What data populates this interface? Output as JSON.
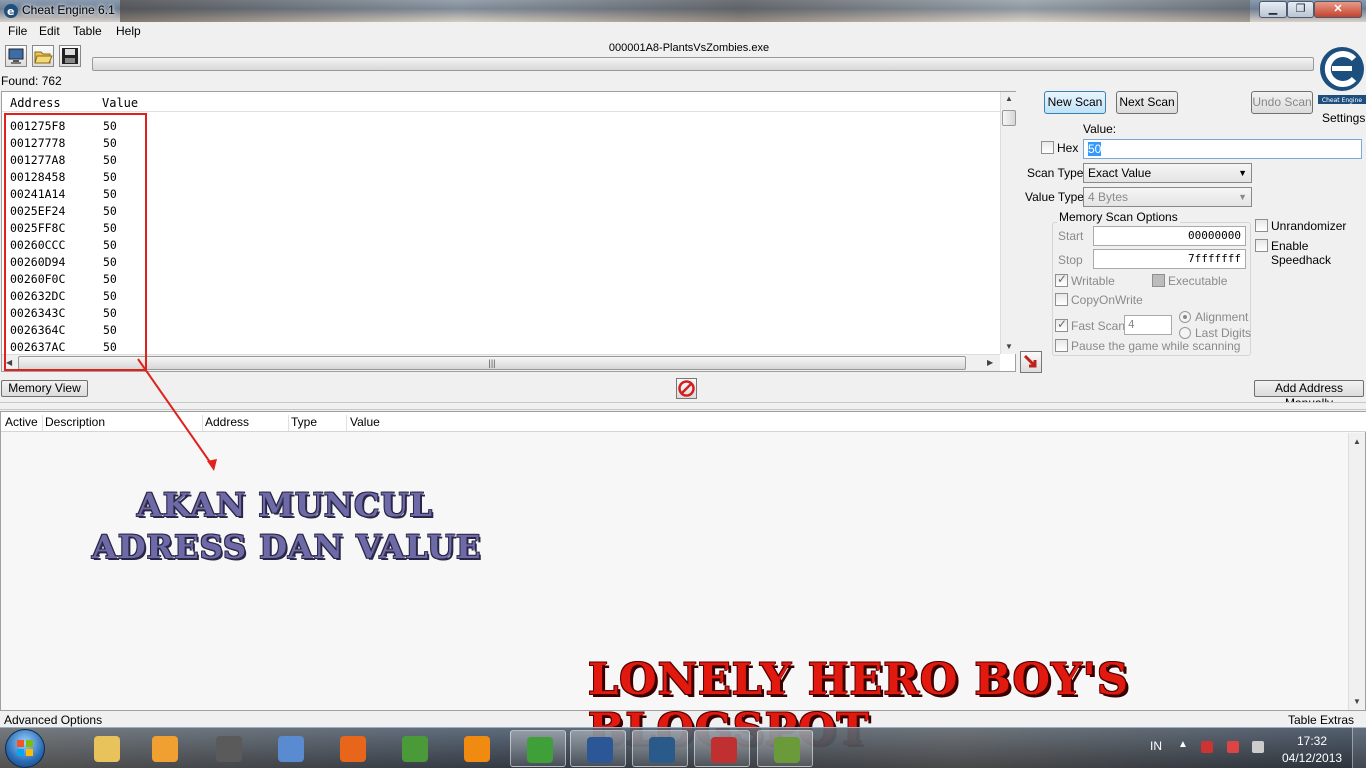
{
  "window": {
    "title": "Cheat Engine 6.1",
    "min_glyph": "▁",
    "max_glyph": "❐",
    "close_glyph": "✕"
  },
  "menu": [
    "File",
    "Edit",
    "Table",
    "Help"
  ],
  "toolbar": {
    "process_title": "000001A8-PlantsVsZombies.exe",
    "open_process_icon": "computer-icon",
    "open_file_icon": "folder-open-icon",
    "save_icon": "floppy-disk-icon"
  },
  "found": "Found: 762",
  "logo": {
    "name": "cheat-engine-logo",
    "text": "Cheat Engine"
  },
  "settings_label": "Settings",
  "results": {
    "columns": [
      "Address",
      "Value"
    ],
    "rows": [
      {
        "address": "001275F8",
        "value": "50"
      },
      {
        "address": "00127778",
        "value": "50"
      },
      {
        "address": "001277A8",
        "value": "50"
      },
      {
        "address": "00128458",
        "value": "50"
      },
      {
        "address": "00241A14",
        "value": "50"
      },
      {
        "address": "0025EF24",
        "value": "50"
      },
      {
        "address": "0025FF8C",
        "value": "50"
      },
      {
        "address": "00260CCC",
        "value": "50"
      },
      {
        "address": "00260D94",
        "value": "50"
      },
      {
        "address": "00260F0C",
        "value": "50"
      },
      {
        "address": "002632DC",
        "value": "50"
      },
      {
        "address": "0026343C",
        "value": "50"
      },
      {
        "address": "0026364C",
        "value": "50"
      },
      {
        "address": "002637AC",
        "value": "50"
      }
    ]
  },
  "scan": {
    "new_scan": "New Scan",
    "next_scan": "Next Scan",
    "undo_scan": "Undo Scan",
    "value_label": "Value:",
    "hex_label": "Hex",
    "hex_checked": false,
    "value": "50",
    "scan_type_label": "Scan Type",
    "scan_type": "Exact Value",
    "value_type_label": "Value Type",
    "value_type": "4 Bytes"
  },
  "memory_options": {
    "title": "Memory Scan Options",
    "start_label": "Start",
    "start": "00000000",
    "stop_label": "Stop",
    "stop": "7fffffff",
    "writable": "Writable",
    "executable": "Executable",
    "copy_on_write": "CopyOnWrite",
    "fast_scan": "Fast Scan",
    "fast_scan_value": "4",
    "alignment": "Alignment",
    "last_digits": "Last Digits",
    "pause_game": "Pause the game while scanning"
  },
  "extra_options": {
    "unrandomizer": "Unrandomizer",
    "enable_speedhack": "Enable Speedhack"
  },
  "buttons": {
    "memory_view": "Memory View",
    "add_address_manually": "Add Address Manually"
  },
  "address_table": {
    "columns": [
      "Active",
      "Description",
      "Address",
      "Type",
      "Value"
    ]
  },
  "footer": {
    "advanced_options": "Advanced Options",
    "table_extras": "Table Extras"
  },
  "annotations": {
    "line1": "AKAN MUNCUL",
    "line2": "ADRESS DAN VALUE",
    "blog_credit": "LONELY HERO BOY'S BLOGSPOT"
  },
  "colors": {
    "annotation_red": "#e2190f",
    "annotation_blue": "#6e6aa8",
    "highlight_box": "#e0221c"
  },
  "taskbar": {
    "apps": [
      {
        "name": "windows-explorer-icon",
        "color": "#e8c25a"
      },
      {
        "name": "media-player-icon",
        "color": "#f0a030"
      },
      {
        "name": "media-player-classic-icon",
        "color": "#5a5a5a"
      },
      {
        "name": "app-diamond-icon",
        "color": "#5a8ad0"
      },
      {
        "name": "firefox-icon",
        "color": "#e8661c"
      },
      {
        "name": "download-manager-icon",
        "color": "#4a9a3a"
      },
      {
        "name": "orange-app-icon",
        "color": "#f08a10"
      },
      {
        "name": "utorrent-icon",
        "color": "#3fa03a"
      },
      {
        "name": "word-icon",
        "color": "#2b5797"
      },
      {
        "name": "cheat-engine-taskbar-icon",
        "color": "#2a5a8a"
      },
      {
        "name": "red-app-icon",
        "color": "#c03030"
      },
      {
        "name": "plants-vs-zombies-icon",
        "color": "#6a9a3a"
      }
    ],
    "language": "IN",
    "time": "17:32",
    "date": "04/12/2013"
  }
}
